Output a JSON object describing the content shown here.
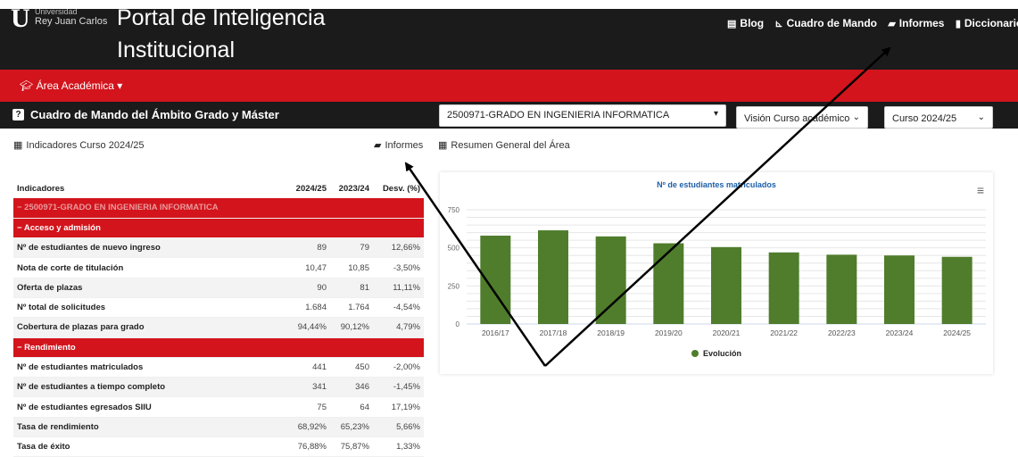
{
  "header": {
    "logo_letter": "U",
    "university_line1": "Universidad",
    "university_line2": "Rey Juan Carlos",
    "portal_title": "Portal de Inteligencia Institucional",
    "nav": [
      {
        "label": "Blog",
        "icon": "newspaper-icon"
      },
      {
        "label": "Cuadro de Mando",
        "icon": "area-chart-icon"
      },
      {
        "label": "Informes",
        "icon": "folder-open-icon"
      },
      {
        "label": "Diccionario",
        "icon": "book-icon"
      }
    ]
  },
  "area_menu": {
    "label": "Área Académica ▾",
    "icon": "graduation-cap-icon"
  },
  "dashboard": {
    "title": "Cuadro de Mando del Ámbito Grado y Máster",
    "degree_select": "2500971-GRADO EN INGENIERIA INFORMATICA",
    "view_select": "Visión Curso académico",
    "course_select": "Curso 2024/25"
  },
  "sublinks": {
    "indicators": "Indicadores Curso 2024/25",
    "reports": "Informes",
    "summary": "Resumen General del Área"
  },
  "table": {
    "headers": [
      "Indicadores",
      "2024/25",
      "2023/24",
      "Desv. (%)"
    ],
    "rows": [
      {
        "type": "group",
        "faded": true,
        "label": "− 2500971-GRADO EN INGENIERIA INFORMATICA"
      },
      {
        "type": "group",
        "label": "− Acceso y admisión"
      },
      {
        "type": "data",
        "label": "Nº de estudiantes de nuevo ingreso",
        "v1": "89",
        "v2": "79",
        "dev": "12,66%"
      },
      {
        "type": "data",
        "label": "Nota de corte de titulación",
        "v1": "10,47",
        "v2": "10,85",
        "dev": "-3,50%"
      },
      {
        "type": "data",
        "label": "Oferta de plazas",
        "v1": "90",
        "v2": "81",
        "dev": "11,11%"
      },
      {
        "type": "data",
        "label": "Nº total de solicitudes",
        "v1": "1.684",
        "v2": "1.764",
        "dev": "-4,54%"
      },
      {
        "type": "data",
        "label": "Cobertura de plazas para grado",
        "v1": "94,44%",
        "v2": "90,12%",
        "dev": "4,79%"
      },
      {
        "type": "group",
        "label": "− Rendimiento"
      },
      {
        "type": "data",
        "label": "Nº de estudiantes matriculados",
        "v1": "441",
        "v2": "450",
        "dev": "-2,00%"
      },
      {
        "type": "data",
        "label": "Nº de estudiantes a tiempo completo",
        "v1": "341",
        "v2": "346",
        "dev": "-1,45%"
      },
      {
        "type": "data",
        "label": "Nº de estudiantes egresados SIIU",
        "v1": "75",
        "v2": "64",
        "dev": "17,19%"
      },
      {
        "type": "data",
        "label": "Tasa de rendimiento",
        "v1": "68,92%",
        "v2": "65,23%",
        "dev": "5,66%"
      },
      {
        "type": "data",
        "label": "Tasa de éxito",
        "v1": "76,88%",
        "v2": "75,87%",
        "dev": "1,33%"
      }
    ]
  },
  "chart_data": {
    "type": "bar",
    "title": "Nº de estudiantes matriculados",
    "categories": [
      "2016/17",
      "2017/18",
      "2018/19",
      "2019/20",
      "2020/21",
      "2021/22",
      "2022/23",
      "2023/24",
      "2024/25"
    ],
    "series": [
      {
        "name": "Evolución",
        "values": [
          580,
          615,
          575,
          530,
          505,
          470,
          455,
          450,
          441
        ]
      }
    ],
    "yticks": [
      "0",
      "250",
      "500",
      "750"
    ],
    "ylim": [
      0,
      750
    ],
    "color": "#4f7d2c",
    "grid": true,
    "legend": "bottom-center"
  },
  "colors": {
    "brand_red": "#d3141c",
    "dark": "#1b1b1b",
    "annotation_arrow": "#000000"
  }
}
